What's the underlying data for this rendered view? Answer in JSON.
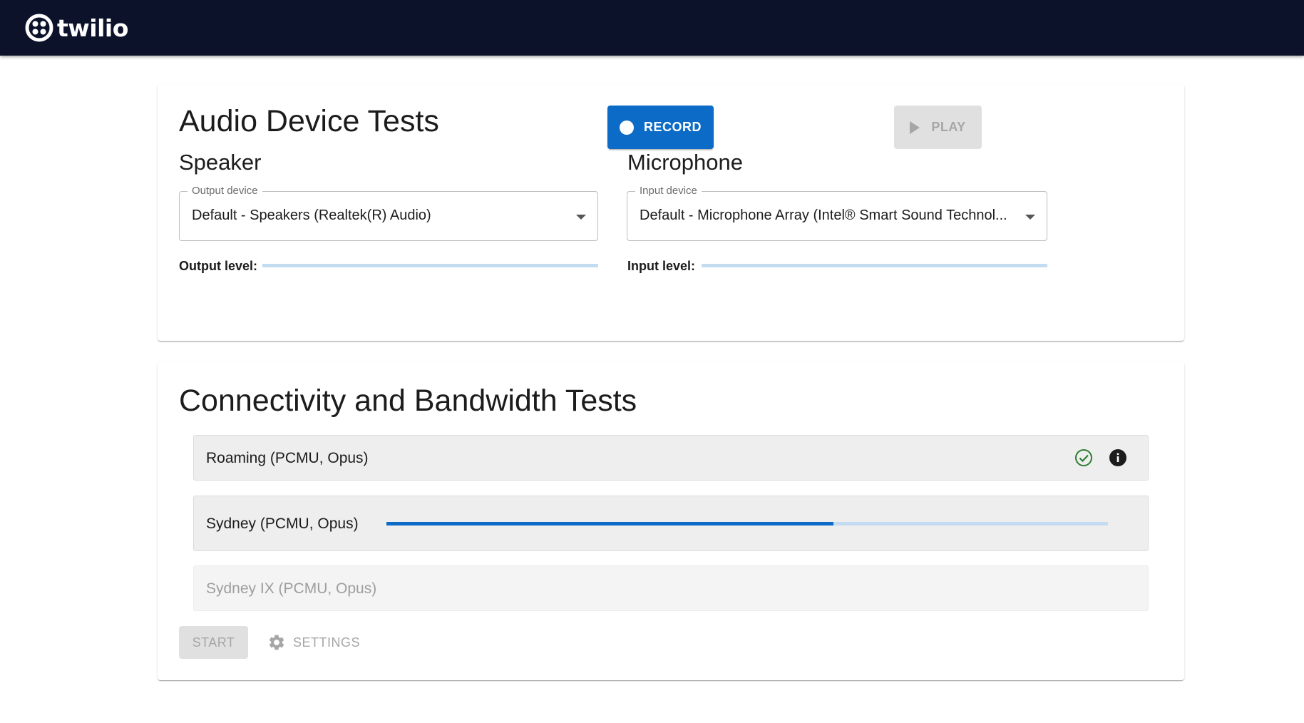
{
  "header": {
    "logo_text": "twilio",
    "brand_color": "#0d122b"
  },
  "audio": {
    "title": "Audio Device Tests",
    "record_label": "RECORD",
    "play_label": "PLAY",
    "speaker": {
      "heading": "Speaker",
      "select_label": "Output device",
      "select_value": "Default - Speakers (Realtek(R) Audio)",
      "level_label": "Output level:",
      "level_fraction": 0
    },
    "microphone": {
      "heading": "Microphone",
      "select_label": "Input device",
      "select_value": "Default - Microphone Array (Intel® Smart Sound Technol...",
      "level_label": "Input level:",
      "level_fraction": 0
    }
  },
  "connectivity": {
    "title": "Connectivity and Bandwidth Tests",
    "tests": [
      {
        "label": "Roaming (PCMU, Opus)",
        "status": "passed",
        "icons": [
          "check-circle-icon",
          "info-icon"
        ]
      },
      {
        "label": "Sydney (PCMU, Opus)",
        "status": "running",
        "progress_fraction": 0.62
      },
      {
        "label": "Sydney IX (PCMU, Opus)",
        "status": "pending"
      }
    ],
    "start_label": "START",
    "settings_label": "SETTINGS",
    "settings_icon": "gear-icon"
  },
  "colors": {
    "accent": "#0b6bc6",
    "success": "#2e7d32",
    "disabled_text": "#a6a6a6"
  }
}
